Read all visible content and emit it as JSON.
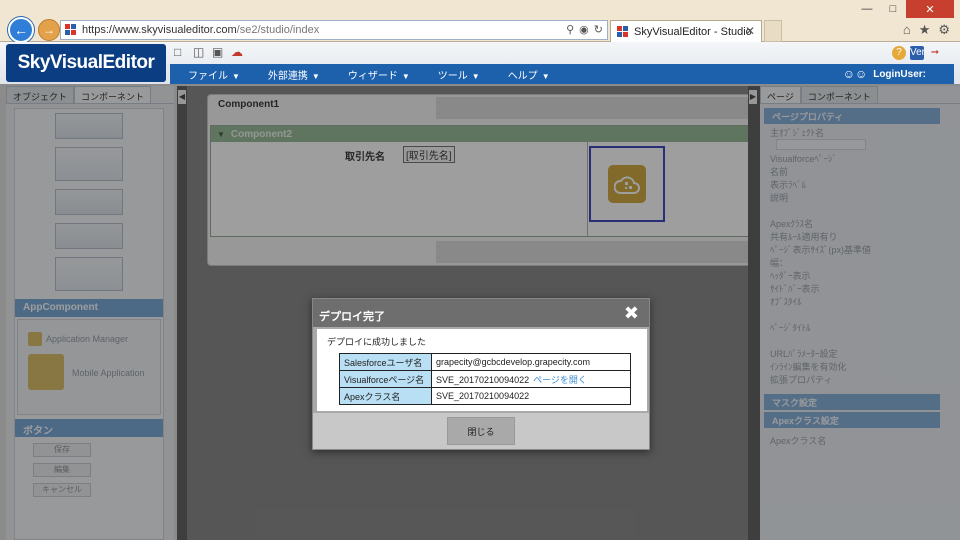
{
  "browser": {
    "url_host": "https://www.skyvisualeditor.com",
    "url_path": "/se2/studio/index",
    "tab_title": "SkyVisualEditor - Studio",
    "tab_close": "✕",
    "window_min": "—",
    "window_max": "□",
    "window_close": "✕"
  },
  "app": {
    "logo": "SkyVisualEditor",
    "menu": [
      {
        "label": "ファイル"
      },
      {
        "label": "外部連携"
      },
      {
        "label": "ウィザード"
      },
      {
        "label": "ツール"
      },
      {
        "label": "ヘルプ"
      }
    ],
    "login_label": "LoginUser:",
    "header_badge": "Ver"
  },
  "left_panel": {
    "tabs": [
      "オブジェクト",
      "コンポーネント"
    ],
    "section_appcomponent": "AppComponent",
    "comp_row_label": "Application Manager",
    "comp_big_label": "Mobile Application",
    "section_button": "ボタン",
    "buttons": [
      "保存",
      "編集",
      "キャンセル"
    ]
  },
  "right_panel": {
    "tabs": [
      "ページ",
      "コンポーネント"
    ],
    "section_page_props": "ページプロパティ",
    "rows": [
      "主ｵﾌﾞｼﾞｪｸﾄ名",
      "Visualforceﾍﾟｰｼﾞ",
      "名前",
      "表示ﾗﾍﾞﾙ",
      "説明",
      "Apexｸﾗｽ名",
      "共有ﾙｰﾙ適用有り",
      "ﾍﾟｰｼﾞ表示ｻｲｽﾞ(px)基準値",
      "幅：",
      "ﾍｯﾀﾞｰ表示",
      "ｻｲﾄﾞﾊﾞｰ表示",
      "ｵﾌﾞｽﾀｲﾙ",
      "ﾍﾟｰｼﾞﾀｲﾄﾙ",
      "URLﾊﾟﾗﾒｰﾀｰ設定",
      "ｲﾝﾗｲﾝ編集を有効化",
      "拡張プロパティ"
    ],
    "section_mask": "マスク設定",
    "section_apex": "Apexクラス設定",
    "apex_row": "Apexクラス名"
  },
  "canvas": {
    "component1": "Component1",
    "component2": "Component2",
    "field_label": "取引先名",
    "field_value": "[取引先名]"
  },
  "modal": {
    "title": "デプロイ完了",
    "message": "デプロイに成功しました",
    "rows": [
      {
        "key": "Salesforceユーザ名",
        "value": "grapecity@gcbcdevelop.grapecity.com",
        "link": ""
      },
      {
        "key": "Visualforceページ名",
        "value": "SVE_20170210094022",
        "link": "ページを開く"
      },
      {
        "key": "Apexクラス名",
        "value": "SVE_20170210094022",
        "link": ""
      }
    ],
    "close_label": "閉じる"
  },
  "colors": {
    "brand": "#0a3d82",
    "menubar": "#1d61ad",
    "section": "#6a9ed4",
    "table_key_bg": "#b9dff4",
    "selection": "#2c33b8",
    "icon_gold": "#caa12d"
  }
}
